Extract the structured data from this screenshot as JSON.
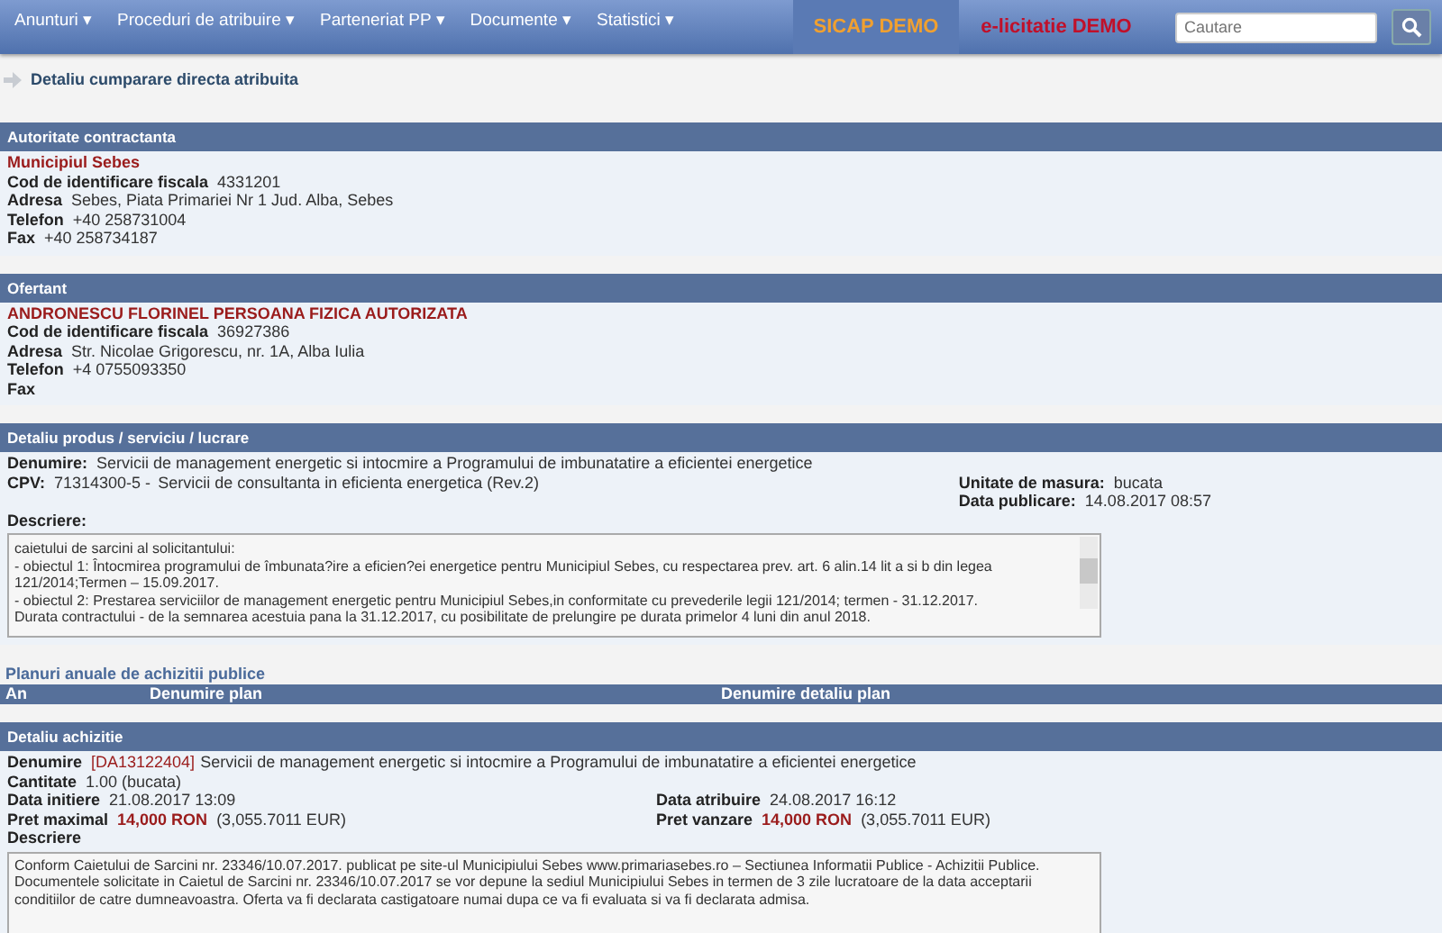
{
  "nav": {
    "menu": [
      {
        "label": "Anunturi",
        "caret": "▾"
      },
      {
        "label": "Proceduri de atribuire",
        "caret": "▾"
      },
      {
        "label": "Parteneriat PP",
        "caret": "▾"
      },
      {
        "label": "Documente",
        "caret": "▾"
      },
      {
        "label": "Statistici",
        "caret": "▾"
      }
    ],
    "demo_links": [
      {
        "label": "SICAP DEMO",
        "color": "#f0a030"
      },
      {
        "label": "e-licitatie DEMO",
        "color": "#c0102a"
      }
    ],
    "search": {
      "placeholder": "Cautare"
    }
  },
  "page_title": "Detaliu cumparare directa atribuita",
  "authority": {
    "title": "Autoritate contractanta",
    "name": "Municipiul Sebes",
    "fields": [
      {
        "label": "Cod de identificare fiscala",
        "value": "4331201"
      },
      {
        "label": "Adresa",
        "value": "Sebes, Piata Primariei Nr 1 Jud. Alba, Sebes"
      },
      {
        "label": "Telefon",
        "value": "+40 258731004"
      },
      {
        "label": "Fax",
        "value": "+40 258734187"
      }
    ]
  },
  "bidder": {
    "title": "Ofertant",
    "name": "ANDRONESCU FLORINEL PERSOANA FIZICA AUTORIZATA",
    "fields": [
      {
        "label": "Cod de identificare fiscala",
        "value": "36927386"
      },
      {
        "label": "Adresa",
        "value": "Str. Nicolae Grigorescu, nr. 1A, Alba Iulia"
      },
      {
        "label": "Telefon",
        "value": "+4 0755093350"
      },
      {
        "label": "Fax"
      }
    ]
  },
  "product": {
    "title": "Detaliu produs / serviciu / lucrare",
    "name_label": "Denumire:",
    "name": "Servicii de management energetic si intocmire a Programului de imbunatatire a eficientei energetice",
    "cpv_label": "CPV:",
    "cpv_code": "71314300-5 -",
    "cpv_name": "Servicii de consultanta in eficienta energetica (Rev.2)",
    "unit_label": "Unitate de masura:",
    "unit": "bucata",
    "published_label": "Data publicare:",
    "published": "14.08.2017 08:57",
    "description_label": "Descriere:",
    "description": "caietului de sarcini al solicitantului:\n- obiectul 1: Întocmirea programului de îmbunata?ire a eficien?ei energetice pentru Municipiul Sebes, cu respectarea prev. art. 6 alin.14 lit a si b din legea 121/2014;Termen – 15.09.2017.\n- obiectul 2: Prestarea serviciilor de management energetic pentru Municipiul Sebes,in conformitate cu prevederile legii 121/2014; termen - 31.12.2017.\nDurata contractului - de la semnarea acestuia pana la 31.12.2017, cu posibilitate de prelungire pe durata primelor 4 luni din anul 2018."
  },
  "plans": {
    "title": "Planuri anuale de achizitii publice",
    "columns": [
      "An",
      "Denumire plan",
      "Denumire detaliu plan"
    ]
  },
  "acquisition": {
    "title": "Detaliu achizitie",
    "name_label": "Denumire",
    "code": "[DA13122404]",
    "name": "Servicii de management energetic si intocmire a Programului de imbunatatire a eficientei energetice",
    "quantity_label": "Cantitate",
    "quantity": "1.00  (bucata)",
    "start_label": "Data initiere",
    "start": "21.08.2017 13:09",
    "award_label": "Data atribuire",
    "award": "24.08.2017 16:12",
    "max_label": "Pret maximal",
    "max_ron": "14,000 RON",
    "max_eur": "(3,055.7011 EUR)",
    "price_label": "Pret vanzare",
    "price_ron": "14,000 RON",
    "price_eur": "(3,055.7011 EUR)",
    "description_label": "Descriere",
    "description": "Conform Caietului de Sarcini nr. 23346/10.07.2017. publicat pe site-ul Municipiului Sebes www.primariasebes.ro – Sectiunea Informatii Publice - Achizitii Publice.\nDocumentele solicitate in Caietul de Sarcini nr. 23346/10.07.2017 se vor depune la sediul Municipiului Sebes in termen de 3 zile lucratoare de la data acceptarii conditiilor de catre dumneavoastra. Oferta va fi declarata castigatoare numai dupa ce va fi evaluata si va fi declarata admisa."
  }
}
